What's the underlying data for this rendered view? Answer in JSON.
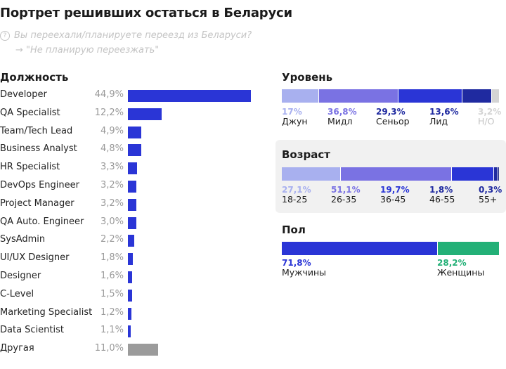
{
  "header": {
    "title": "Портрет решивших остаться в Беларуси",
    "question_icon": "question-circle-icon",
    "question": "Вы переехали/планируете переезд из Беларуси?",
    "answer_arrow": "→",
    "answer": "\"Не планирую переезжать\""
  },
  "colors": {
    "primary_blue": "#2a35d6",
    "other_gray": "#9b9b9b",
    "light_lavender": "#a8b0ef",
    "mid_purple": "#7a72e3",
    "dark_navy": "#1f2aa0",
    "na_gray": "#d4d4d4",
    "green": "#23b077",
    "card_bg": "#f1f1f1"
  },
  "chart_data": [
    {
      "type": "bar",
      "orientation": "horizontal",
      "title": "Должность",
      "categories": [
        "Developer",
        "QA Specialist",
        "Team/Tech Lead",
        "Business Analyst",
        "HR Specialist",
        "DevOps Engineer",
        "Project Manager",
        "QA Auto. Engineer",
        "SysAdmin",
        "UI/UX Designer",
        "Designer",
        "C-Level",
        "Marketing Specialist",
        "Data Scientist",
        "Другая"
      ],
      "values": [
        44.9,
        12.2,
        4.9,
        4.8,
        3.3,
        3.2,
        3.2,
        3.0,
        2.2,
        1.8,
        1.6,
        1.5,
        1.2,
        1.1,
        11.0
      ],
      "value_labels": [
        "44,9%",
        "12,2%",
        "4,9%",
        "4,8%",
        "3,3%",
        "3,2%",
        "3,2%",
        "3,0%",
        "2,2%",
        "1,8%",
        "1,6%",
        "1,5%",
        "1,2%",
        "1,1%",
        "11,0%"
      ],
      "highlight_other_index": 14,
      "unit": "%"
    },
    {
      "type": "bar",
      "orientation": "stacked-horizontal",
      "title": "Уровень",
      "categories": [
        "Джун",
        "Мидл",
        "Сеньор",
        "Лид",
        "Н/О"
      ],
      "values": [
        17.0,
        36.8,
        29.3,
        13.6,
        3.2
      ],
      "value_labels": [
        "17%",
        "36,8%",
        "29,3%",
        "13,6%",
        "3,2%"
      ],
      "colors": [
        "#a8b0ef",
        "#7a72e3",
        "#2a35d6",
        "#1f2aa0",
        "#d4d4d4"
      ],
      "pct_text_colors": [
        "#a8b0ef",
        "#7a72e3",
        "#1f2aa0",
        "#1f2aa0",
        "#d4d4d4"
      ],
      "faded": [
        false,
        false,
        false,
        false,
        true
      ]
    },
    {
      "type": "bar",
      "orientation": "stacked-horizontal",
      "title": "Возраст",
      "categories": [
        "18-25",
        "26-35",
        "36-45",
        "46-55",
        "55+"
      ],
      "values": [
        27.1,
        51.1,
        19.7,
        1.8,
        0.3
      ],
      "value_labels": [
        "27,1%",
        "51,1%",
        "19,7%",
        "1,8%",
        "0,3%"
      ],
      "colors": [
        "#a8b0ef",
        "#7a72e3",
        "#2a35d6",
        "#1f2aa0",
        "#161f80"
      ],
      "pct_text_colors": [
        "#a8b0ef",
        "#7a72e3",
        "#2a35d6",
        "#1f2aa0",
        "#1f2aa0"
      ],
      "faded": [
        false,
        false,
        false,
        false,
        false
      ]
    },
    {
      "type": "bar",
      "orientation": "stacked-horizontal",
      "title": "Пол",
      "categories": [
        "Мужчины",
        "Женщины"
      ],
      "values": [
        71.8,
        28.2
      ],
      "value_labels": [
        "71,8%",
        "28,2%"
      ],
      "colors": [
        "#2a35d6",
        "#23b077"
      ],
      "pct_text_colors": [
        "#2a35d6",
        "#23b077"
      ],
      "faded": [
        false,
        false
      ]
    }
  ]
}
